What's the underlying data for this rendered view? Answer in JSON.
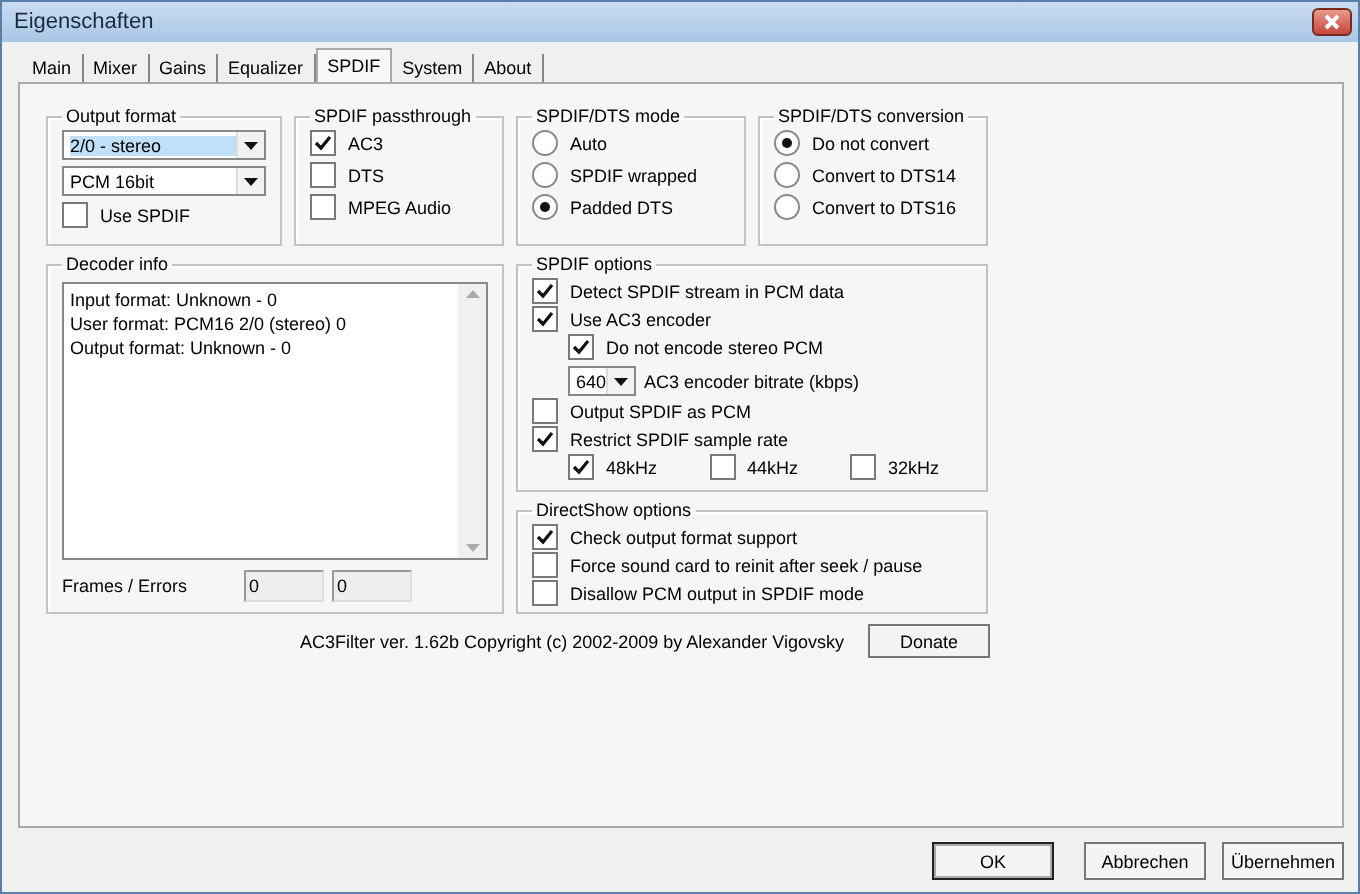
{
  "window": {
    "title": "Eigenschaften"
  },
  "tabs": [
    {
      "label": "Main",
      "selected": false
    },
    {
      "label": "Mixer",
      "selected": false
    },
    {
      "label": "Gains",
      "selected": false
    },
    {
      "label": "Equalizer",
      "selected": false
    },
    {
      "label": "SPDIF",
      "selected": true
    },
    {
      "label": "System",
      "selected": false
    },
    {
      "label": "About",
      "selected": false
    }
  ],
  "output_format": {
    "title": "Output format",
    "dropdowns": [
      {
        "value": "2/0 - stereo",
        "focused": true
      },
      {
        "value": "PCM 16bit",
        "focused": false
      }
    ],
    "checkboxes": [
      {
        "label": "Use SPDIF",
        "checked": false
      }
    ]
  },
  "spdif_passthrough": {
    "title": "SPDIF passthrough",
    "checkboxes": [
      {
        "label": "AC3",
        "checked": true
      },
      {
        "label": "DTS",
        "checked": false
      },
      {
        "label": "MPEG Audio",
        "checked": false
      }
    ]
  },
  "spdif_dts_mode": {
    "title": "SPDIF/DTS mode",
    "options": [
      {
        "label": "Auto",
        "selected": false
      },
      {
        "label": "SPDIF wrapped",
        "selected": false
      },
      {
        "label": "Padded DTS",
        "selected": true
      }
    ]
  },
  "spdif_dts_conversion": {
    "title": "SPDIF/DTS conversion",
    "options": [
      {
        "label": "Do not convert",
        "selected": true
      },
      {
        "label": "Convert to DTS14",
        "selected": false
      },
      {
        "label": "Convert to DTS16",
        "selected": false
      }
    ]
  },
  "decoder_info": {
    "title": "Decoder info",
    "lines": [
      "Input format: Unknown - 0",
      "User format: PCM16 2/0 (stereo) 0",
      "Output format: Unknown - 0"
    ],
    "frames_label": "Frames / Errors",
    "frames": "0",
    "errors": "0"
  },
  "spdif_options": {
    "title": "SPDIF options",
    "items": [
      {
        "kind": "checkbox",
        "label": "Detect SPDIF stream in PCM data",
        "checked": true
      },
      {
        "kind": "checkbox",
        "label": "Use AC3 encoder",
        "checked": true,
        "children": [
          {
            "kind": "checkbox",
            "label": "Do not encode stereo PCM",
            "checked": true
          },
          {
            "kind": "dropdown",
            "value": "640",
            "label": "AC3 encoder bitrate (kbps)"
          }
        ]
      },
      {
        "kind": "checkbox",
        "label": "Output SPDIF as PCM",
        "checked": false
      },
      {
        "kind": "checkbox",
        "label": "Restrict SPDIF sample rate",
        "checked": true,
        "children": [
          {
            "kind": "checkbox-row",
            "checkboxes": [
              {
                "label": "48kHz",
                "checked": true
              },
              {
                "label": "44kHz",
                "checked": false
              },
              {
                "label": "32kHz",
                "checked": false
              }
            ]
          }
        ]
      }
    ]
  },
  "directshow_options": {
    "title": "DirectShow options",
    "checkboxes": [
      {
        "label": "Check output format support",
        "checked": true
      },
      {
        "label": "Force sound card to reinit after seek / pause",
        "checked": false
      },
      {
        "label": "Disallow PCM output in SPDIF mode",
        "checked": false
      }
    ]
  },
  "footer": {
    "copyright": "AC3Filter ver. 1.62b Copyright (c) 2002-2009 by Alexander Vigovsky",
    "donate": "Donate"
  },
  "buttons": [
    {
      "label": "OK",
      "default": true
    },
    {
      "label": "Abbrechen",
      "default": false
    },
    {
      "label": "Übernehmen",
      "default": false
    }
  ]
}
